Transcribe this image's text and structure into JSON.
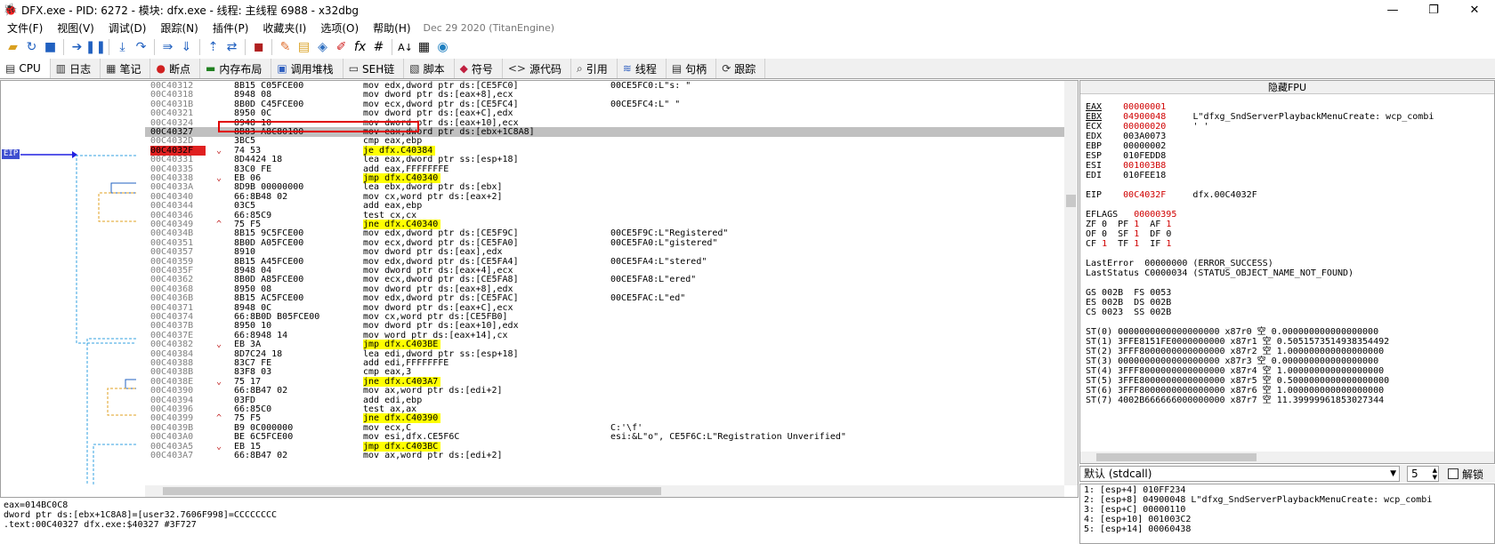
{
  "title": "DFX.exe - PID: 6272 - 模块: dfx.exe - 线程: 主线程 6988 - x32dbg",
  "window_buttons": [
    "—",
    "❐",
    "✕"
  ],
  "menu": [
    "文件(F)",
    "视图(V)",
    "调试(D)",
    "跟踪(N)",
    "插件(P)",
    "收藏夹(I)",
    "选项(O)",
    "帮助(H)"
  ],
  "build_stamp": "Dec 29 2020 (TitanEngine)",
  "toolbar": [
    "open-icon",
    "restart-icon",
    "stop-icon",
    "run-icon",
    "pause-icon",
    "step-into-icon",
    "step-over-icon",
    "trace-into-icon",
    "trace-over-icon",
    "execute-till-return-icon",
    "run-to-user-code-icon",
    "scylla-icon",
    "patch-icon",
    "comment-icon",
    "label-icon",
    "bookmark-icon",
    "breakpoint-icon",
    "function-icon",
    "hash-icon",
    "font-icon",
    "calculator-icon",
    "globe-icon"
  ],
  "tabs": [
    {
      "label": "CPU",
      "icon": "▤"
    },
    {
      "label": "日志",
      "icon": "▥"
    },
    {
      "label": "笔记",
      "icon": "▦"
    },
    {
      "label": "断点",
      "icon": "●"
    },
    {
      "label": "内存布局",
      "icon": "▬"
    },
    {
      "label": "调用堆栈",
      "icon": "▣"
    },
    {
      "label": "SEH链",
      "icon": "▭"
    },
    {
      "label": "脚本",
      "icon": "▧"
    },
    {
      "label": "符号",
      "icon": "◆"
    },
    {
      "label": "源代码",
      "icon": "<>"
    },
    {
      "label": "引用",
      "icon": "⌕"
    },
    {
      "label": "线程",
      "icon": "≋"
    },
    {
      "label": "句柄",
      "icon": "▤"
    },
    {
      "label": "跟踪",
      "icon": "⟳"
    }
  ],
  "eip_label": "EIP",
  "disasm": [
    {
      "addr": "00C40312",
      "arrow": "",
      "bytes": "8B15 C05FCE00",
      "ins": "mov edx,dword ptr ds:[CE5FC0]",
      "cmt": "00CE5FC0:L\"s: \""
    },
    {
      "addr": "00C40318",
      "arrow": "",
      "bytes": "8948 08",
      "ins": "mov dword ptr ds:[eax+8],ecx",
      "cmt": ""
    },
    {
      "addr": "00C4031B",
      "arrow": "",
      "bytes": "8B0D C45FCE00",
      "ins": "mov ecx,dword ptr ds:[CE5FC4]",
      "cmt": "00CE5FC4:L\" \""
    },
    {
      "addr": "00C40321",
      "arrow": "",
      "bytes": "8950 0C",
      "ins": "mov dword ptr ds:[eax+C],edx",
      "cmt": ""
    },
    {
      "addr": "00C40324",
      "arrow": "",
      "bytes": "8948 10",
      "ins": "mov dword ptr ds:[eax+10],ecx",
      "cmt": ""
    },
    {
      "addr": "00C40327",
      "arrow": "",
      "bytes": "8B83 A8C80100",
      "ins": "mov eax,dword ptr ds:[ebx+1C8A8]",
      "cmt": ""
    },
    {
      "addr": "00C4032D",
      "arrow": "",
      "bytes": "3BC5",
      "ins": "cmp eax,ebp",
      "cmt": ""
    },
    {
      "addr": "00C4032F",
      "arrow": "⌄",
      "bytes": "74 53",
      "ins": "je dfx.C40384",
      "cmt": ""
    },
    {
      "addr": "00C40331",
      "arrow": "",
      "bytes": "8D4424 18",
      "ins": "lea eax,dword ptr ss:[esp+18]",
      "cmt": ""
    },
    {
      "addr": "00C40335",
      "arrow": "",
      "bytes": "83C0 FE",
      "ins": "add eax,FFFFFFFE",
      "cmt": ""
    },
    {
      "addr": "00C40338",
      "arrow": "⌄",
      "bytes": "EB 06",
      "ins": "jmp dfx.C40340",
      "cmt": ""
    },
    {
      "addr": "00C4033A",
      "arrow": "",
      "bytes": "8D9B 00000000",
      "ins": "lea ebx,dword ptr ds:[ebx]",
      "cmt": ""
    },
    {
      "addr": "00C40340",
      "arrow": "",
      "bytes": "66:8B48 02",
      "ins": "mov cx,word ptr ds:[eax+2]",
      "cmt": ""
    },
    {
      "addr": "00C40344",
      "arrow": "",
      "bytes": "03C5",
      "ins": "add eax,ebp",
      "cmt": ""
    },
    {
      "addr": "00C40346",
      "arrow": "",
      "bytes": "66:85C9",
      "ins": "test cx,cx",
      "cmt": ""
    },
    {
      "addr": "00C40349",
      "arrow": "^",
      "bytes": "75 F5",
      "ins": "jne dfx.C40340",
      "cmt": ""
    },
    {
      "addr": "00C4034B",
      "arrow": "",
      "bytes": "8B15 9C5FCE00",
      "ins": "mov edx,dword ptr ds:[CE5F9C]",
      "cmt": "00CE5F9C:L\"Registered\""
    },
    {
      "addr": "00C40351",
      "arrow": "",
      "bytes": "8B0D A05FCE00",
      "ins": "mov ecx,dword ptr ds:[CE5FA0]",
      "cmt": "00CE5FA0:L\"gistered\""
    },
    {
      "addr": "00C40357",
      "arrow": "",
      "bytes": "8910",
      "ins": "mov dword ptr ds:[eax],edx",
      "cmt": ""
    },
    {
      "addr": "00C40359",
      "arrow": "",
      "bytes": "8B15 A45FCE00",
      "ins": "mov edx,dword ptr ds:[CE5FA4]",
      "cmt": "00CE5FA4:L\"stered\""
    },
    {
      "addr": "00C4035F",
      "arrow": "",
      "bytes": "8948 04",
      "ins": "mov dword ptr ds:[eax+4],ecx",
      "cmt": ""
    },
    {
      "addr": "00C40362",
      "arrow": "",
      "bytes": "8B0D A85FCE00",
      "ins": "mov ecx,dword ptr ds:[CE5FA8]",
      "cmt": "00CE5FA8:L\"ered\""
    },
    {
      "addr": "00C40368",
      "arrow": "",
      "bytes": "8950 08",
      "ins": "mov dword ptr ds:[eax+8],edx",
      "cmt": ""
    },
    {
      "addr": "00C4036B",
      "arrow": "",
      "bytes": "8B15 AC5FCE00",
      "ins": "mov edx,dword ptr ds:[CE5FAC]",
      "cmt": "00CE5FAC:L\"ed\""
    },
    {
      "addr": "00C40371",
      "arrow": "",
      "bytes": "8948 0C",
      "ins": "mov dword ptr ds:[eax+C],ecx",
      "cmt": ""
    },
    {
      "addr": "00C40374",
      "arrow": "",
      "bytes": "66:8B0D B05FCE00",
      "ins": "mov cx,word ptr ds:[CE5FB0]",
      "cmt": ""
    },
    {
      "addr": "00C4037B",
      "arrow": "",
      "bytes": "8950 10",
      "ins": "mov dword ptr ds:[eax+10],edx",
      "cmt": ""
    },
    {
      "addr": "00C4037E",
      "arrow": "",
      "bytes": "66:8948 14",
      "ins": "mov word ptr ds:[eax+14],cx",
      "cmt": ""
    },
    {
      "addr": "00C40382",
      "arrow": "⌄",
      "bytes": "EB 3A",
      "ins": "jmp dfx.C403BE",
      "cmt": ""
    },
    {
      "addr": "00C40384",
      "arrow": "",
      "bytes": "8D7C24 18",
      "ins": "lea edi,dword ptr ss:[esp+18]",
      "cmt": ""
    },
    {
      "addr": "00C40388",
      "arrow": "",
      "bytes": "83C7 FE",
      "ins": "add edi,FFFFFFFE",
      "cmt": ""
    },
    {
      "addr": "00C4038B",
      "arrow": "",
      "bytes": "83F8 03",
      "ins": "cmp eax,3",
      "cmt": ""
    },
    {
      "addr": "00C4038E",
      "arrow": "⌄",
      "bytes": "75 17",
      "ins": "jne dfx.C403A7",
      "cmt": ""
    },
    {
      "addr": "00C40390",
      "arrow": "",
      "bytes": "66:8B47 02",
      "ins": "mov ax,word ptr ds:[edi+2]",
      "cmt": ""
    },
    {
      "addr": "00C40394",
      "arrow": "",
      "bytes": "03FD",
      "ins": "add edi,ebp",
      "cmt": ""
    },
    {
      "addr": "00C40396",
      "arrow": "",
      "bytes": "66:85C0",
      "ins": "test ax,ax",
      "cmt": ""
    },
    {
      "addr": "00C40399",
      "arrow": "^",
      "bytes": "75 F5",
      "ins": "jne dfx.C40390",
      "cmt": ""
    },
    {
      "addr": "00C4039B",
      "arrow": "",
      "bytes": "B9 0C000000",
      "ins": "mov ecx,C",
      "cmt": "C:'\\f'"
    },
    {
      "addr": "00C403A0",
      "arrow": "",
      "bytes": "BE 6C5FCE00",
      "ins": "mov esi,dfx.CE5F6C",
      "cmt": "esi:&L\"o\", CE5F6C:L\"Registration Unverified\""
    },
    {
      "addr": "00C403A5",
      "arrow": "⌄",
      "bytes": "EB 15",
      "ins": "jmp dfx.C403BC",
      "cmt": ""
    },
    {
      "addr": "00C403A7",
      "arrow": "",
      "bytes": "66:8B47 02",
      "ins": "mov ax,word ptr ds:[edi+2]",
      "cmt": ""
    }
  ],
  "info_lines": [
    "eax=014BC0C8",
    "dword ptr ds:[ebx+1C8A8]=[user32.7606F998]=CCCCCCCC",
    "",
    ".text:00C40327 dfx.exe:$40327 #3F727"
  ],
  "reg_header": "隐藏FPU",
  "registers": [
    "EAX",
    "EBX",
    "ECX",
    "EDX",
    "EBP",
    "ESP",
    "ESI",
    "EDI"
  ],
  "reg_values": [
    "00000001",
    "04900048",
    "00000020",
    "003A0073",
    "00000002",
    "010FEDD8",
    "001003B8",
    "010FEE18"
  ],
  "reg_comments": [
    "",
    "L\"dfxg_SndServerPlaybackMenuCreate: wcp_combi",
    "' '",
    "",
    "",
    "",
    "",
    ""
  ],
  "eip_line": "EIP    00C4032F     dfx.00C4032F",
  "eflags_label": "EFLAGS",
  "eflags_value": "00000395",
  "flag_lines": [
    "ZF 0  PF 1  AF 1",
    "OF 0  SF 1  DF 0",
    "CF 1  TF 1  IF 1"
  ],
  "last_error": "LastError  00000000 (ERROR_SUCCESS)",
  "last_status": "LastStatus C0000034 (STATUS_OBJECT_NAME_NOT_FOUND)",
  "seg_lines": [
    "GS 002B  FS 0053",
    "ES 002B  DS 002B",
    "CS 0023  SS 002B"
  ],
  "fpu_lines": [
    "ST(0) 0000000000000000000 x87r0 空 0.000000000000000000",
    "ST(1) 3FFE8151FE0000000000 x87r1 空 0.5051573514938354492",
    "ST(2) 3FFF8000000000000000 x87r2 空 1.000000000000000000",
    "ST(3) 0000000000000000000 x87r3 空 0.000000000000000000",
    "ST(4) 3FFF8000000000000000 x87r4 空 1.000000000000000000",
    "ST(5) 3FFE8000000000000000 x87r5 空 0.5000000000000000000",
    "ST(6) 3FFF8000000000000000 x87r6 空 1.000000000000000000",
    "ST(7) 4002B666666000000000 x87r7 空 11.39999961853027344"
  ],
  "callconv": "默认 (stdcall)",
  "arg_count": "5",
  "unlock_label": "解锁",
  "stack_lines": [
    "1: [esp+4] 010FF234",
    "2: [esp+8] 04900048 L\"dfxg_SndServerPlaybackMenuCreate: wcp_combi",
    "3: [esp+C] 00000110",
    "4: [esp+10] 001003C2",
    "5: [esp+14] 00060438"
  ],
  "colors": {
    "eip_badge": "#3f4fd0",
    "jump_highlight": "#ffff00",
    "selected_row": "#c0c0c0",
    "changed_register": "#d00000",
    "selection_box": "#e00000"
  }
}
